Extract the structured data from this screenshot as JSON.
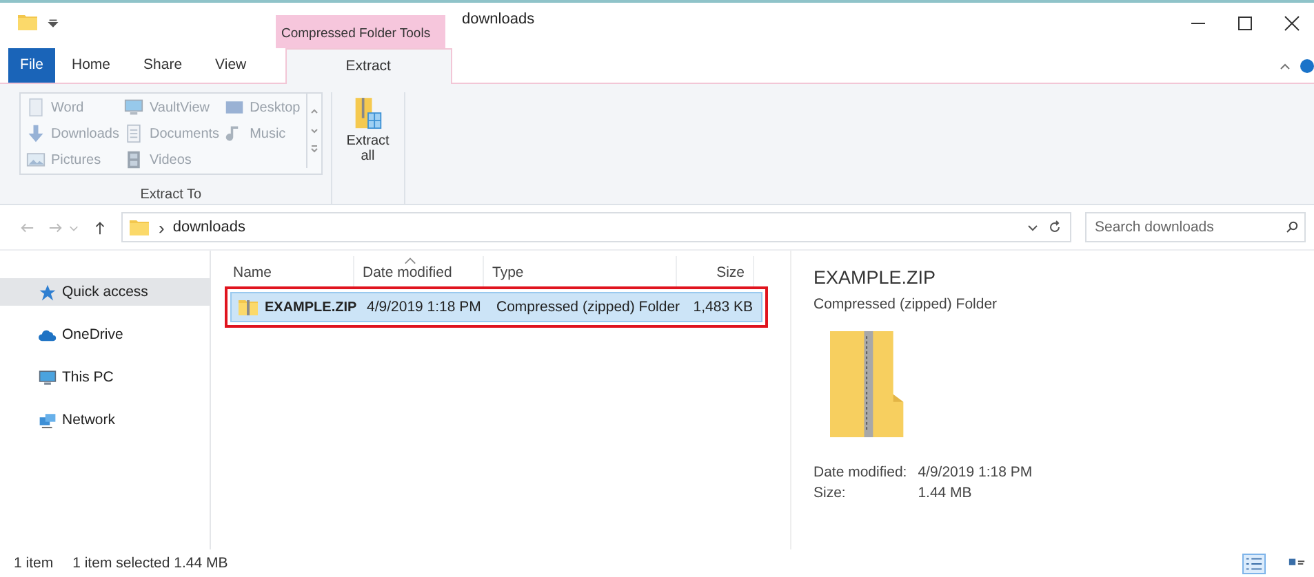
{
  "title_bar": {
    "tool_tab": "Compressed Folder Tools",
    "title": "downloads"
  },
  "ribbon_tabs": [
    {
      "label": "File",
      "kind": "file",
      "selected": false
    },
    {
      "label": "Home",
      "kind": "tab",
      "selected": false
    },
    {
      "label": "Share",
      "kind": "tab",
      "selected": false
    },
    {
      "label": "View",
      "kind": "tab",
      "selected": false
    },
    {
      "label": "Extract",
      "kind": "tab",
      "selected": true
    }
  ],
  "extract_to": {
    "items": [
      {
        "label": "Word",
        "kind": "doc"
      },
      {
        "label": "VaultView",
        "kind": "pc"
      },
      {
        "label": "Desktop",
        "kind": "desk"
      },
      {
        "label": "Downloads",
        "kind": "down"
      },
      {
        "label": "Documents",
        "kind": "docs"
      },
      {
        "label": "Music",
        "kind": "note"
      },
      {
        "label": "Pictures",
        "kind": "pic"
      },
      {
        "label": "Videos",
        "kind": "film"
      }
    ],
    "group_label": "Extract To"
  },
  "extract_all": {
    "label": "Extract all"
  },
  "address": {
    "separator": "›",
    "path": "downloads"
  },
  "search": {
    "placeholder": "Search downloads"
  },
  "nav_pane": [
    {
      "label": "Quick access",
      "kind": "star",
      "selected": true
    },
    {
      "label": "OneDrive",
      "kind": "cloud",
      "selected": false
    },
    {
      "label": "This PC",
      "kind": "pc",
      "selected": false
    },
    {
      "label": "Network",
      "kind": "net",
      "selected": false
    }
  ],
  "file_list": {
    "columns": [
      {
        "label": "Name",
        "sorted": false
      },
      {
        "label": "Date modified",
        "sorted": true
      },
      {
        "label": "Type",
        "sorted": false
      },
      {
        "label": "Size",
        "sorted": false
      }
    ],
    "rows": [
      {
        "cells": [
          "EXAMPLE.ZIP",
          "4/9/2019 1:18 PM",
          "Compressed (zipped) Folder",
          "1,483 KB"
        ],
        "selected": true,
        "highlighted": true
      }
    ]
  },
  "preview": {
    "name": "EXAMPLE.ZIP",
    "type": "Compressed (zipped) Folder",
    "details": [
      {
        "label": "Date modified:",
        "value": "4/9/2019 1:18 PM"
      },
      {
        "label": "Size:",
        "value": "1.44 MB"
      }
    ]
  },
  "status_bar": {
    "count": "1 item",
    "selection": "1 item selected  1.44 MB",
    "views": [
      {
        "kind": "details",
        "selected": true
      },
      {
        "kind": "tiles",
        "selected": false
      }
    ]
  }
}
